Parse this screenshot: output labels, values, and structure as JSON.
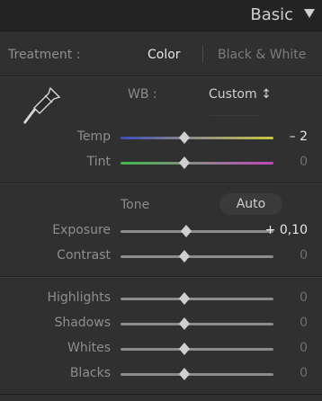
{
  "header": {
    "title": "Basic",
    "collapse_icon": "triangle-down-icon"
  },
  "treatment": {
    "label": "Treatment :",
    "color_option": "Color",
    "bw_option": "Black & White"
  },
  "wb": {
    "label": "WB :",
    "value": "Custom ↕",
    "eyedropper_icon": "eyedropper-icon"
  },
  "sliders": {
    "temp": {
      "label": "Temp",
      "value": "– 2"
    },
    "tint": {
      "label": "Tint",
      "value": "0"
    },
    "exposure": {
      "label": "Exposure",
      "value": "+ 0,10"
    },
    "contrast": {
      "label": "Contrast",
      "value": "0"
    },
    "highlights": {
      "label": "Highlights",
      "value": "0"
    },
    "shadows": {
      "label": "Shadows",
      "value": "0"
    },
    "whites": {
      "label": "Whites",
      "value": "0"
    },
    "blacks": {
      "label": "Blacks",
      "value": "0"
    }
  },
  "tone": {
    "label": "Tone",
    "auto_label": "Auto"
  },
  "colors": {
    "bg": "#303030",
    "header_bg": "#242424",
    "temp_gradient_start": "#3a4fb8",
    "temp_gradient_end": "#c9c544",
    "tint_gradient_start": "#40b84a",
    "tint_gradient_end": "#c044c0"
  }
}
